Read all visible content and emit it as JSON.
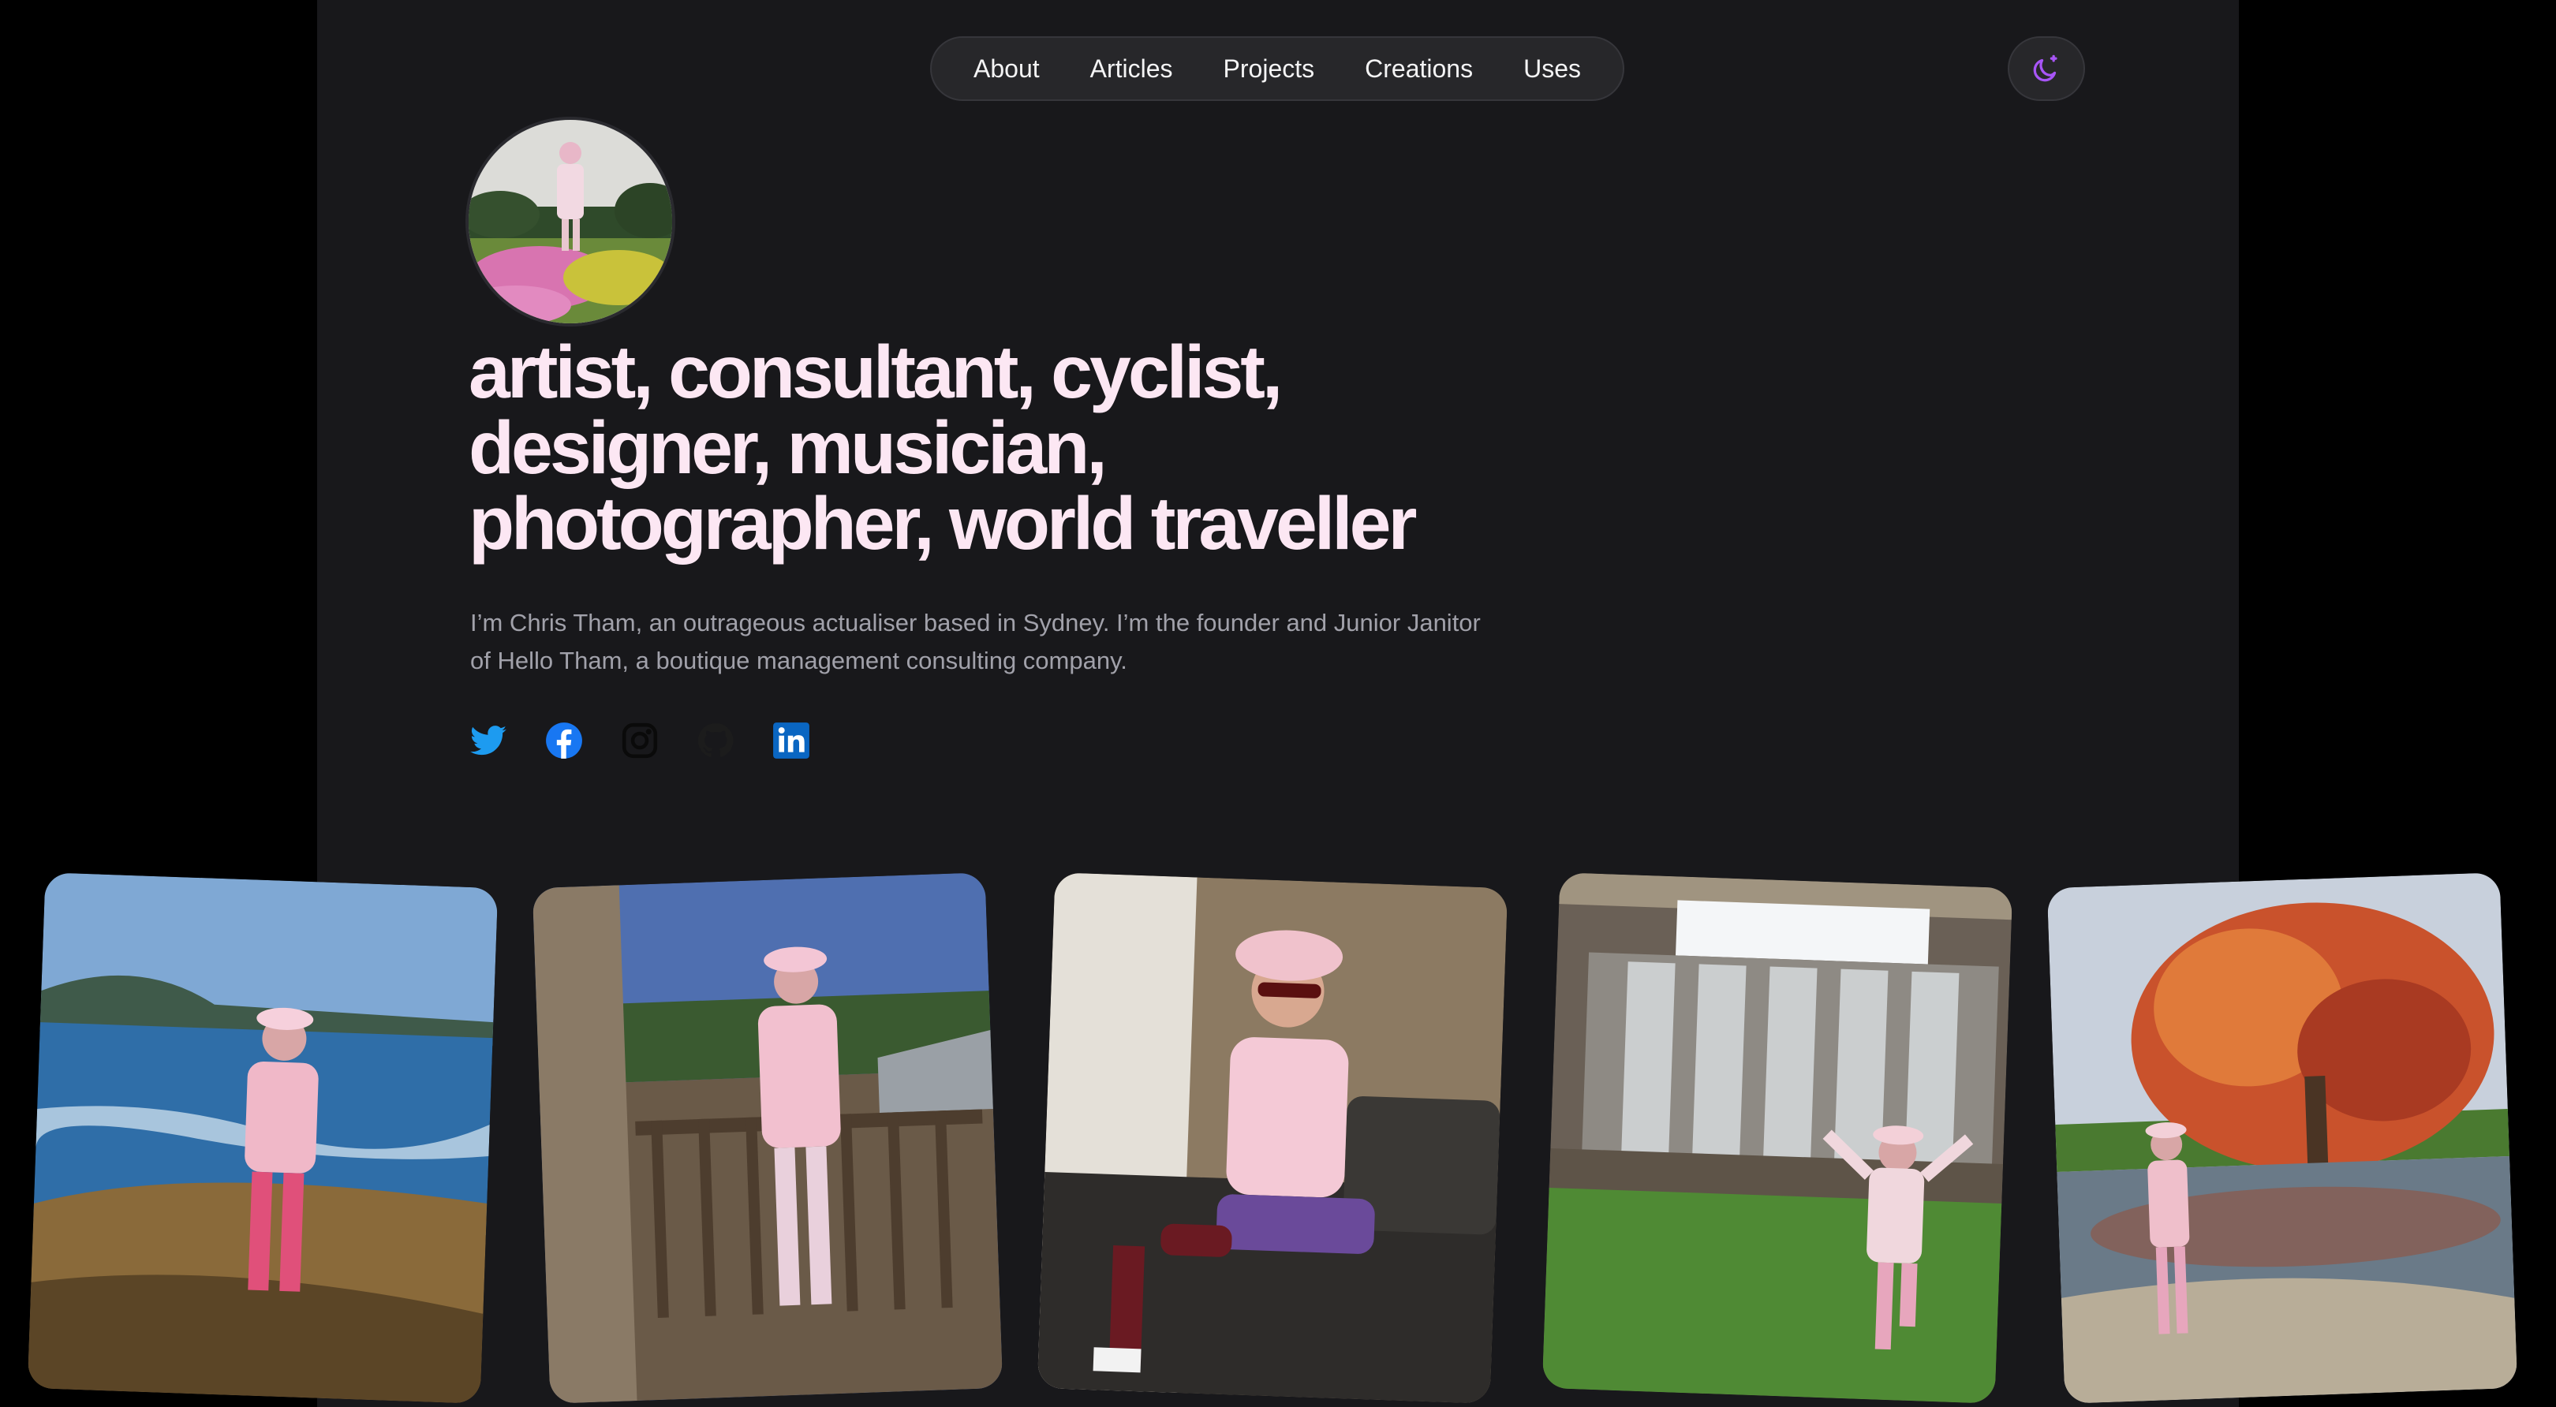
{
  "nav": {
    "items": [
      {
        "label": "About"
      },
      {
        "label": "Articles"
      },
      {
        "label": "Projects"
      },
      {
        "label": "Creations"
      },
      {
        "label": "Uses"
      }
    ],
    "theme_icon": "moon-sparkle-icon"
  },
  "hero": {
    "headline": "artist, consultant, cyclist, designer, musician, photographer, world traveller",
    "intro": "I’m Chris Tham, an outrageous actualiser based in Sydney. I’m the founder and Junior Janitor of Hello Tham, a boutique management consulting company."
  },
  "socials": [
    {
      "icon": "twitter-icon",
      "color": "#1d9bf0"
    },
    {
      "icon": "facebook-icon",
      "color": "#1877f2"
    },
    {
      "icon": "instagram-icon",
      "color": "#0a0a0a"
    },
    {
      "icon": "github-icon",
      "color": "#1c1c1c"
    },
    {
      "icon": "linkedin-icon",
      "color": "#0a66c2"
    }
  ],
  "colors": {
    "page_bg": "#000000",
    "panel_bg": "#18181b",
    "headline": "#fce7f3",
    "accent": "#a855f7"
  },
  "photos": [
    {
      "subject": "woman in pink sitting on coastal rocks by the sea"
    },
    {
      "subject": "woman in pink on a wooden deck beside a tree"
    },
    {
      "subject": "woman in pink hat and sunglasses seated on a couch"
    },
    {
      "subject": "woman in pink jumping in front of a waterfall weir"
    },
    {
      "subject": "woman in pink by a pond with an autumn tree"
    }
  ]
}
